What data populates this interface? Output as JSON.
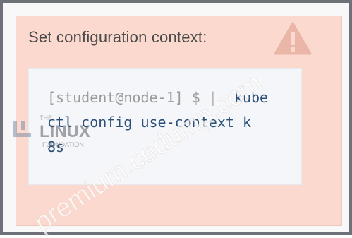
{
  "panel": {
    "title": "Set configuration context:",
    "code": {
      "prompt": "[student@node-1] $",
      "separator": "|",
      "line1_cmd": "kube",
      "line2": "ctl config use-context k",
      "line3": "8s"
    },
    "icons": {
      "warning": "warning-triangle-icon"
    }
  },
  "logo": {
    "the": "THE",
    "linux": "LINUX",
    "foundation": "FOUNDATION"
  },
  "watermark": {
    "text": "premium.cedump.com"
  },
  "colors": {
    "panel_bg": "#fbd9cf",
    "code_bg": "#f4f6f9",
    "code_text": "#2b5078",
    "frame": "#6f7179"
  }
}
